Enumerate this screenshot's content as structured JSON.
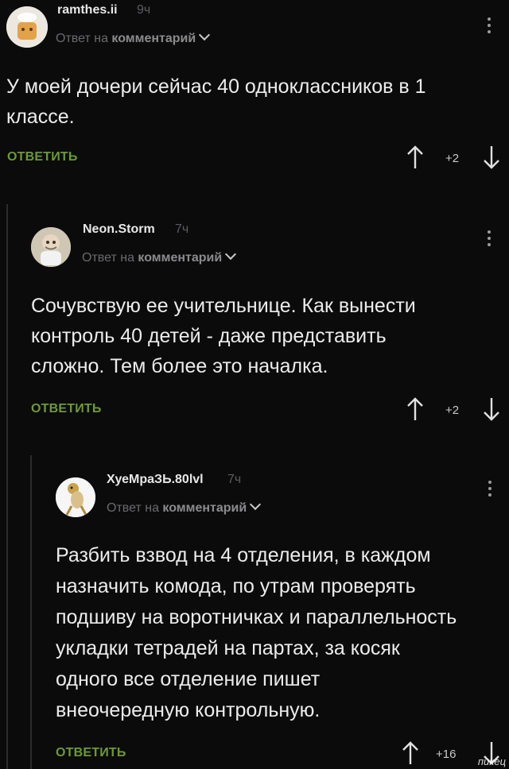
{
  "comments": [
    {
      "username": "ramthes.ii",
      "time": "9ч",
      "reply_prefix": "Ответ на",
      "reply_target": "комментарий",
      "text": "У моей дочери сейчас 40 одноклассников в 1 классе.",
      "reply_label": "ОТВЕТИТЬ",
      "score": "+2"
    },
    {
      "username": "Neon.Storm",
      "time": "7ч",
      "reply_prefix": "Ответ на",
      "reply_target": "комментарий",
      "text": "Сочувствую ее учительнице. Как вынести контроль 40 детей - даже представить сложно. Тем более это началка.",
      "reply_label": "ОТВЕТИТЬ",
      "score": "+2"
    },
    {
      "username": "ХуеМраЗЬ.80lvl",
      "time": "7ч",
      "reply_prefix": "Ответ на",
      "reply_target": "комментарий",
      "text": "Разбить взвод на 4 отделения, в каждом назначить комода, по утрам проверять подшиву на воротничках и параллельность укладки тетрадей на партах, за косяк одного все отделение пишет внеочередную контрольную.",
      "reply_label": "ОТВЕТИТЬ",
      "score": "+16"
    }
  ],
  "icons": {
    "upvote": "arrow-up-icon",
    "downvote": "arrow-down-icon",
    "menu": "kebab-menu-icon",
    "expand": "chevron-down-icon"
  },
  "colors": {
    "background": "#0b0b0c",
    "reply_button": "#6b9a33",
    "thread_line": "#2c2c2e"
  },
  "watermark": "пикец"
}
